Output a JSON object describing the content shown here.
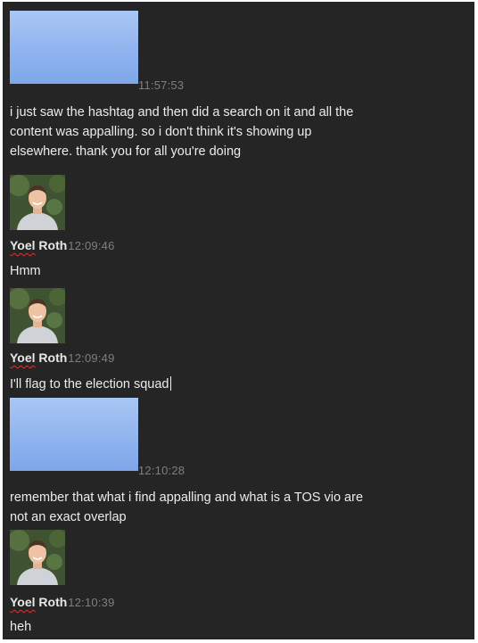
{
  "messages": [
    {
      "avatar": "redacted",
      "time": "11:57:53",
      "text_lines": [
        "i just saw the hashtag and then did a search on it and all the",
        "content was appalling. so i don't think it's showing up",
        "elsewhere. thank you for all you're doing"
      ]
    },
    {
      "avatar": "photo",
      "author": "Yoel Roth",
      "time": "12:09:46",
      "text_lines": [
        "Hmm"
      ]
    },
    {
      "avatar": "photo",
      "author": "Yoel Roth",
      "time": "12:09:49",
      "text_lines": [
        "I'll flag to the election squad"
      ]
    },
    {
      "avatar": "redacted",
      "time": "12:10:28",
      "text_lines": [
        "remember that what i find appalling and what is a TOS vio are",
        "not an exact overlap"
      ]
    },
    {
      "avatar": "photo",
      "author": "Yoel Roth",
      "time": "12:10:39",
      "text_lines": [
        "heh"
      ]
    }
  ],
  "colors": {
    "background": "#252525",
    "text": "#ececec",
    "timestamp": "#7f7f7f",
    "redacted_block": "#90b4ef",
    "spellcheck_underline": "#dd3333"
  },
  "icons": {
    "redacted_avatar": "redacted-avatar-block",
    "user_avatar": "user-photo-icon"
  }
}
